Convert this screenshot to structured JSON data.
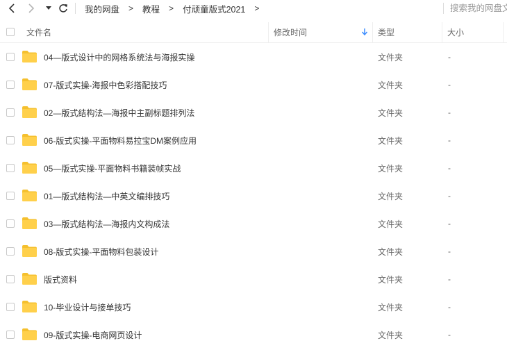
{
  "toolbar": {
    "breadcrumb": [
      "我的网盘",
      "教程",
      "付顽童版式2021"
    ],
    "breadcrumb_separator": ">",
    "search_placeholder": "搜索我的网盘文件"
  },
  "columns": {
    "name": "文件名",
    "modified": "修改时间",
    "type": "类型",
    "size": "大小"
  },
  "files": [
    {
      "name": "04—版式设计中的网格系统法与海报实操",
      "type": "文件夹",
      "size": "-"
    },
    {
      "name": "07-版式实操-海报中色彩搭配技巧",
      "type": "文件夹",
      "size": "-"
    },
    {
      "name": "02—版式结构法—海报中主副标题排列法",
      "type": "文件夹",
      "size": "-"
    },
    {
      "name": "06-版式实操-平面物料易拉宝DM案例应用",
      "type": "文件夹",
      "size": "-"
    },
    {
      "name": "05—版式实操-平面物料书籍装帧实战",
      "type": "文件夹",
      "size": "-"
    },
    {
      "name": "01—版式结构法—中英文编排技巧",
      "type": "文件夹",
      "size": "-"
    },
    {
      "name": "03—版式结构法—海报内文构成法",
      "type": "文件夹",
      "size": "-"
    },
    {
      "name": "08-版式实操-平面物料包装设计",
      "type": "文件夹",
      "size": "-"
    },
    {
      "name": "版式资料",
      "type": "文件夹",
      "size": "-"
    },
    {
      "name": "10-毕业设计与接单技巧",
      "type": "文件夹",
      "size": "-"
    },
    {
      "name": "09-版式实操-电商网页设计",
      "type": "文件夹",
      "size": "-"
    }
  ],
  "colors": {
    "folder": "#ffd04b",
    "folder_tab": "#f5c02e",
    "sort_arrow": "#3b8cff",
    "text": "#333333",
    "muted": "#666666"
  }
}
